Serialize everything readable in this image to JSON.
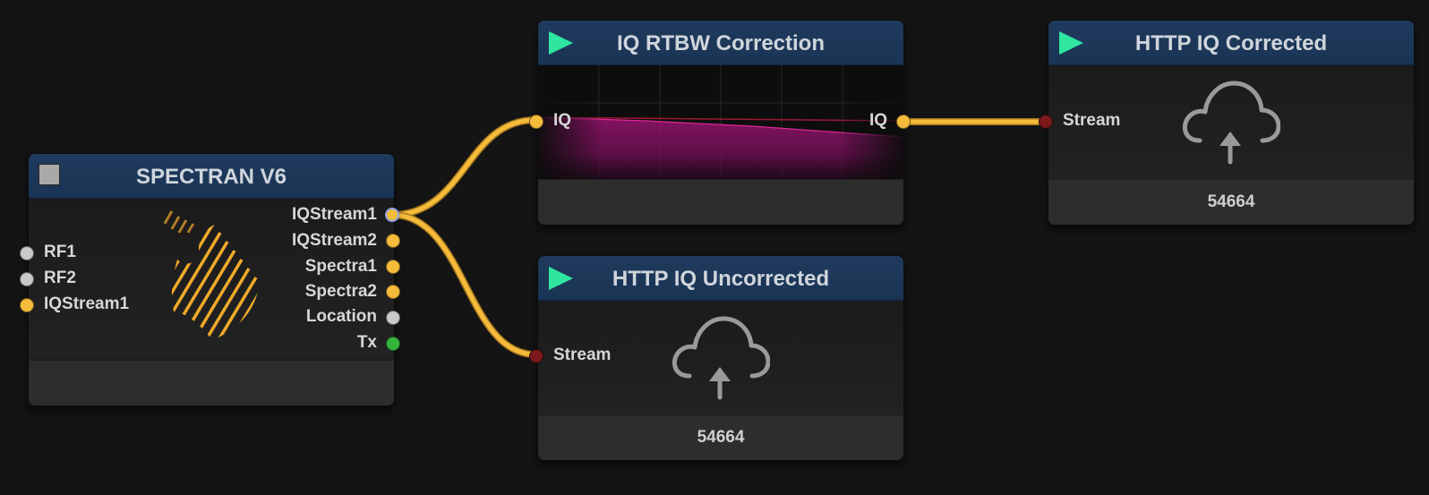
{
  "nodes": {
    "spectran": {
      "title": "SPECTRAN V6",
      "inputs": [
        "RF1",
        "RF2",
        "IQStream1"
      ],
      "outputs": [
        "IQStream1",
        "IQStream2",
        "Spectra1",
        "Spectra2",
        "Location",
        "Tx"
      ]
    },
    "rtbw": {
      "title": "IQ RTBW Correction",
      "input": "IQ",
      "output": "IQ"
    },
    "uncorrected": {
      "title": "HTTP IQ Uncorrected",
      "input": "Stream",
      "port_value": "54664"
    },
    "corrected": {
      "title": "HTTP IQ Corrected",
      "input": "Stream",
      "port_value": "54664"
    }
  },
  "icons": {
    "play": "play-icon",
    "stop": "stop-icon",
    "cloud": "cloud-upload-icon",
    "logo": "spectran-logo"
  },
  "colors": {
    "canvas_bg": "#141414",
    "header_bg": "#1c3658",
    "play_green": "#2fe6a0",
    "wire": "#f5bb3a",
    "port_yellow": "#f5bb3a",
    "port_grey": "#c9c9c9",
    "port_green": "#35b43e",
    "port_red": "#7a1a1a",
    "spectrum_magenta": "#c0168a"
  }
}
